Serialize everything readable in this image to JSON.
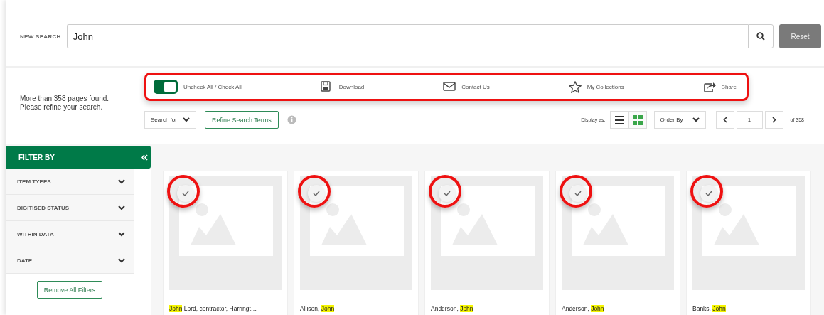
{
  "search": {
    "label": "NEW SEARCH",
    "value": "John",
    "reset": "Reset"
  },
  "result_message": [
    "More than 358 pages found.",
    "Please refine your search."
  ],
  "toolbar": {
    "highlighted": true,
    "items": [
      {
        "kind": "toggle",
        "label": "Uncheck All / Check All",
        "on": true
      },
      {
        "kind": "download",
        "label": "Download"
      },
      {
        "kind": "mail",
        "label": "Contact Us"
      },
      {
        "kind": "star",
        "label": "My Collections"
      },
      {
        "kind": "share",
        "label": "Share"
      }
    ]
  },
  "controls": {
    "search_for": "Search for",
    "refine": "Refine Search Terms",
    "display_label": "Display as:",
    "views": [
      {
        "kind": "list",
        "selected": false
      },
      {
        "kind": "grid",
        "selected": true
      }
    ],
    "order_by": "Order By",
    "page": "1",
    "of_pages": "of 358"
  },
  "filter": {
    "title": "FILTER BY",
    "items": [
      {
        "label": "ITEM TYPES",
        "expanded": false
      },
      {
        "label": "DIGITISED STATUS",
        "expanded": false
      },
      {
        "label": "WITHIN DATA",
        "expanded": false
      },
      {
        "label": "DATE",
        "expanded": false
      }
    ],
    "remove": "Remove All Filters"
  },
  "cards": [
    {
      "circled": true,
      "title": [
        {
          "text": "John",
          "highlight": true
        },
        {
          "text": " Lord, contractor, Harringt…",
          "highlight": false
        }
      ]
    },
    {
      "circled": true,
      "title": [
        {
          "text": "Allison, ",
          "highlight": false
        },
        {
          "text": "John",
          "highlight": true
        }
      ]
    },
    {
      "circled": true,
      "title": [
        {
          "text": "Anderson, ",
          "highlight": false
        },
        {
          "text": "John",
          "highlight": true
        }
      ]
    },
    {
      "circled": true,
      "title": [
        {
          "text": "Anderson, ",
          "highlight": false
        },
        {
          "text": "John",
          "highlight": true
        }
      ]
    },
    {
      "circled": true,
      "title": [
        {
          "text": "Banks, ",
          "highlight": false
        },
        {
          "text": "John",
          "highlight": true
        }
      ]
    }
  ]
}
